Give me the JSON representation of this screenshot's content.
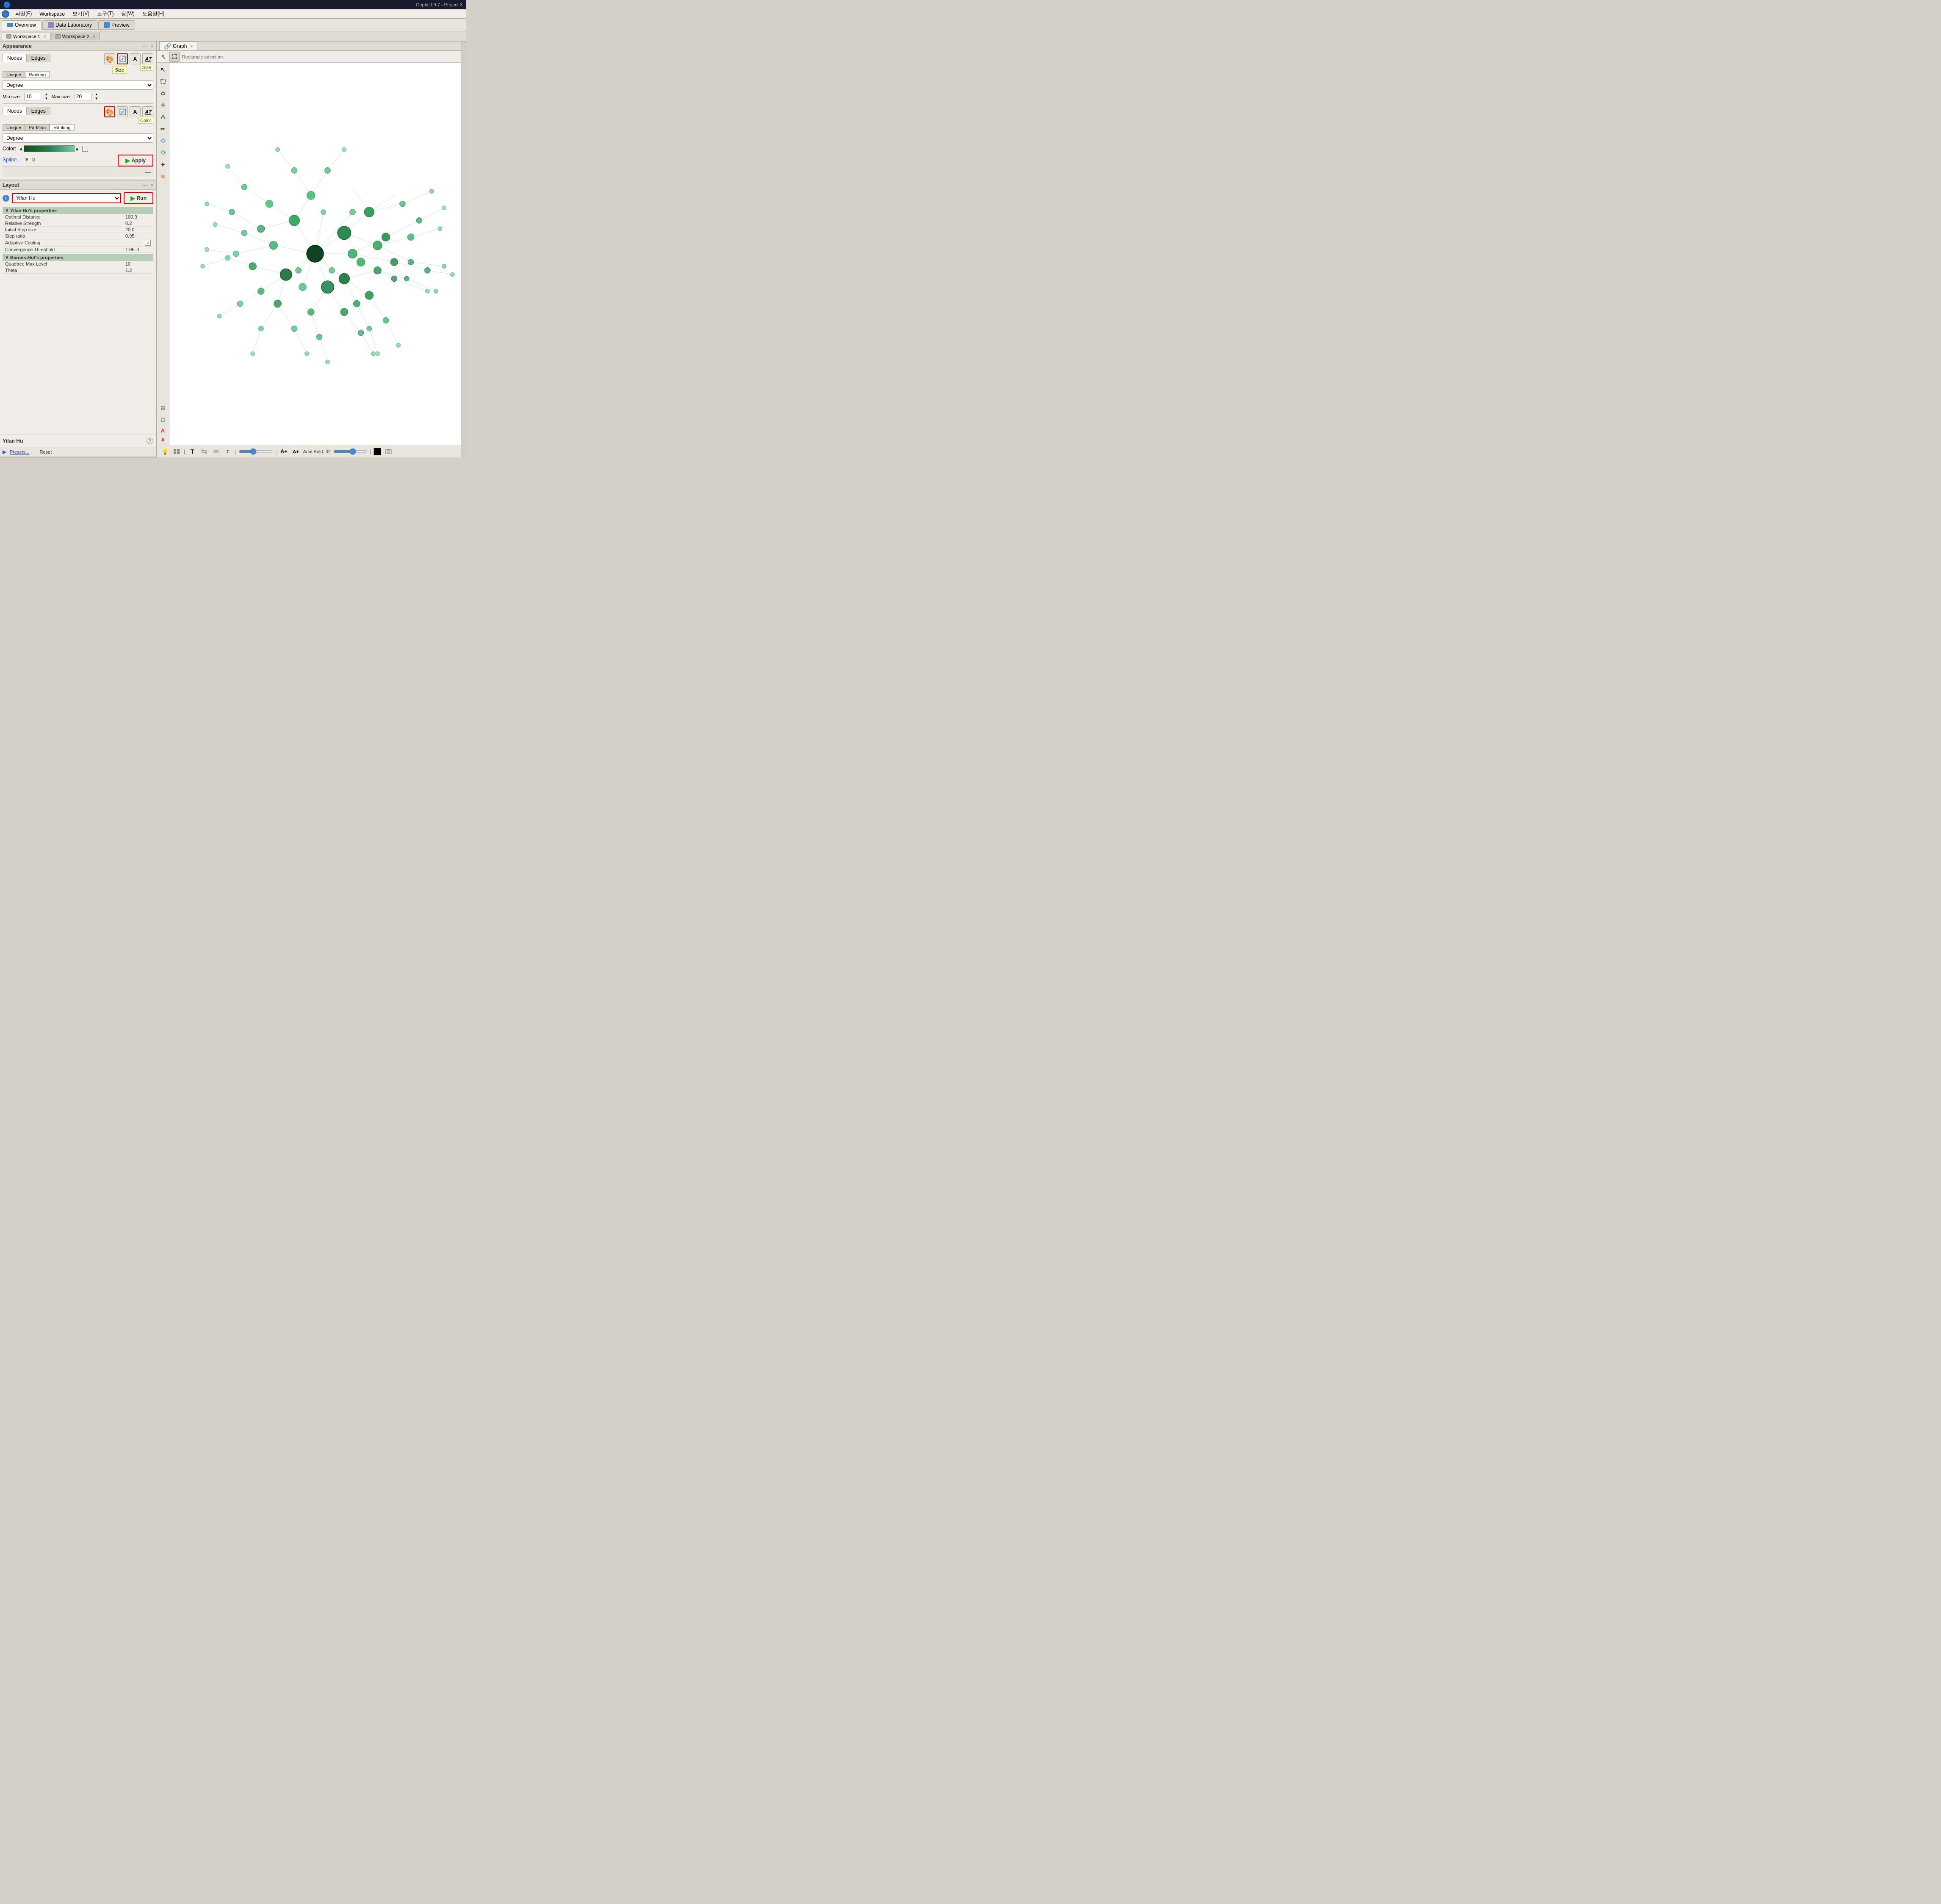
{
  "app": {
    "title": "Gephi 0.9.7 - Project 3"
  },
  "menu": {
    "items": [
      "파일(F)",
      "Workspace",
      "보기(V)",
      "도구(T)",
      "장(W)",
      "도움말(H)"
    ]
  },
  "toolbar_tabs": [
    {
      "id": "overview",
      "label": "Overview",
      "active": true
    },
    {
      "id": "data-lab",
      "label": "Data Laboratory",
      "active": false
    },
    {
      "id": "preview",
      "label": "Preview",
      "active": false
    }
  ],
  "workspace_tabs": [
    {
      "id": "ws1",
      "label": "Workspace 1",
      "active": true
    },
    {
      "id": "ws2",
      "label": "Workspace 2",
      "active": false
    }
  ],
  "appearance_panel": {
    "title": "Appearance",
    "nodes_label": "Nodes",
    "edges_label": "Edges",
    "unique_label": "Unique",
    "ranking_label": "Ranking",
    "partition_label": "Partition",
    "size_tooltip": "Size",
    "color_tooltip": "Color",
    "degree_label": "Degree",
    "min_size_label": "Min size:",
    "max_size_label": "Max size:",
    "min_size_value": "10",
    "max_size_value": "20",
    "color_label": "Color:",
    "spline_label": "Spline...",
    "apply_label": "Apply"
  },
  "layout_panel": {
    "title": "Layout",
    "algorithm_label": "Yifan Hu",
    "run_label": "Run",
    "info_text": "i",
    "properties_title": "Yifan Hu's properties",
    "properties": [
      {
        "name": "Optimal Distance",
        "value": "100.0"
      },
      {
        "name": "Relative Strength",
        "value": "0.2"
      },
      {
        "name": "Initial Step size",
        "value": "20.0"
      },
      {
        "name": "Step ratio",
        "value": "0.95"
      },
      {
        "name": "Adaptive Cooling",
        "value": "checkbox",
        "checked": true
      },
      {
        "name": "Convergence Threshold",
        "value": "1.0E-4"
      }
    ],
    "barnes_hut_title": "Barnes-Hut's properties",
    "barnes_props": [
      {
        "name": "Quadtree Max Level",
        "value": "10"
      },
      {
        "name": "Theta",
        "value": "1.2"
      }
    ],
    "footer_name": "Yifan Hu",
    "presets_label": "Presets...",
    "reset_label": "Reset"
  },
  "graph_panel": {
    "title": "Graph",
    "rect_select_label": "Rectangle selection"
  },
  "bottom_toolbar": {
    "font_name": "Arial Bold, 32"
  },
  "icons": {
    "play": "▶",
    "arrow": "↖",
    "rect_select": "⬚",
    "lasso": "⬡",
    "drag": "✥",
    "zoom_in": "🔍",
    "pencil": "✏",
    "path": "⬆",
    "airplane": "✈",
    "settings": "⚙",
    "light": "💡",
    "layers": "▦",
    "text_a": "A",
    "text_a2": "A",
    "color_swatch": "🎨",
    "copy": "⧉",
    "filter": "▼"
  }
}
